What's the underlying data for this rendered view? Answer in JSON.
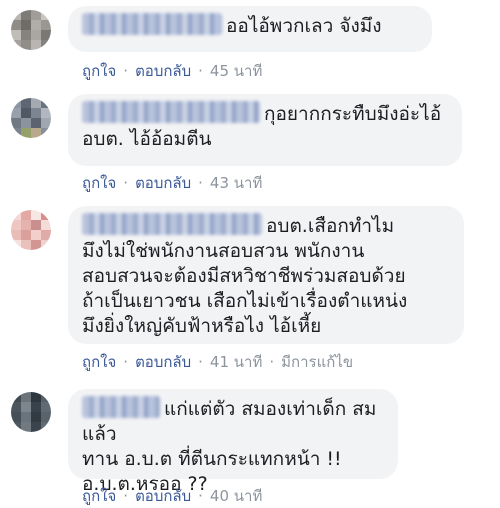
{
  "comments": [
    {
      "avatar_palette": [
        "#b8b5b0",
        "#7d7b78",
        "#a09d99",
        "#c9c6c1",
        "#8f8c88",
        "#6e6c69",
        "#b1aeaa",
        "#9a9793",
        "#c0bdb8",
        "#86837f",
        "#aaa7a3",
        "#7a7875",
        "#a5a29e",
        "#918e8a",
        "#b9b6b1",
        "#848280"
      ],
      "text": "ออไอ้พวกเลว จังมึง",
      "like": "ถูกใจ",
      "reply": "ตอบกลับ",
      "time": "45 นาที"
    },
    {
      "avatar_palette": [
        "#8c93a1",
        "#5d6672",
        "#a4a9b2",
        "#6a7380",
        "#98a0ab",
        "#4f5863",
        "#7c8591",
        "#b2b7bf",
        "#6f7884",
        "#8b939e",
        "#5a636f",
        "#a0a7b0",
        "#7a838f",
        "#96a06a",
        "#b8a98c",
        "#868f9a"
      ],
      "text": "กุอยากกระทืบมึงอ่ะไอ้\nอบต. ไอ้อ้อมตีน",
      "like": "ถูกใจ",
      "reply": "ตอบกลับ",
      "time": "43 นาที"
    },
    {
      "avatar_palette": [
        "#f3d8d6",
        "#e4a9a4",
        "#f7e6e3",
        "#d98e8b",
        "#f0c6c2",
        "#e6b2ae",
        "#c98f8c",
        "#f4dcd9",
        "#e9bcb8",
        "#d9a09c",
        "#f2cfcb",
        "#e0aaa6",
        "#f5e1de",
        "#ebc1bd",
        "#d39591",
        "#eed0cc"
      ],
      "text": "อบต.เสือกทำไม\nมึงไม่ใช่พนักงานสอบสวน พนักงาน\nสอบสวนจะต้องมีสหวิชาชีพร่วมสอบด้วย\nถ้าเป็นเยาวชน เสือกไม่เข้าเรื่องตำแหน่ง\nมึงยิ่งใหญ่คับฟ้าหรือไง ไอ้เหี้ย",
      "like": "ถูกใจ",
      "reply": "ตอบกลับ",
      "time": "41 นาที",
      "edited": "มีการแก้ไข"
    },
    {
      "avatar_palette": [
        "#3f4a52",
        "#6b747b",
        "#2e373e",
        "#56616a",
        "#4a555d",
        "#7d868d",
        "#38424a",
        "#5f6a72",
        "#444f57",
        "#6a747c",
        "#323b42",
        "#58636b",
        "#4d5860",
        "#717a81",
        "#3a444c",
        "#606b73"
      ],
      "text": "แก่แต่ตัว สมองเท่าเด็ก สมแล้ว\nทาน อ.บ.ต ที่ตีนกระแทกหน้า !!\nอ.บ.ต.หรออ ??",
      "like": "ถูกใจ",
      "reply": "ตอบกลับ",
      "time": "40 นาที"
    }
  ]
}
